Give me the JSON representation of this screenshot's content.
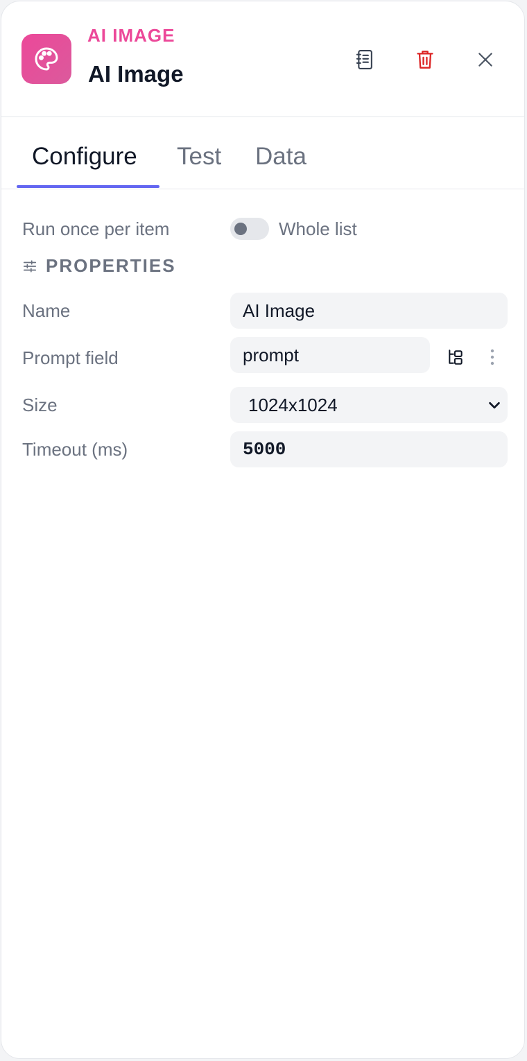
{
  "header": {
    "kind_label": "AI IMAGE",
    "title": "AI Image",
    "icon": "palette-icon",
    "accent_color": "#ec4899",
    "actions": [
      "docs-icon",
      "trash-icon",
      "close-icon"
    ]
  },
  "tabs": [
    {
      "label": "Configure",
      "active": true
    },
    {
      "label": "Test",
      "active": false
    },
    {
      "label": "Data",
      "active": false
    }
  ],
  "run_mode": {
    "label": "Run once per item",
    "toggle_text": "Whole list",
    "enabled": false
  },
  "properties": {
    "section_title": "PROPERTIES",
    "name": {
      "label": "Name",
      "value": "AI Image"
    },
    "prompt_field": {
      "label": "Prompt field",
      "value": "prompt"
    },
    "size": {
      "label": "Size",
      "value": "1024x1024"
    },
    "timeout": {
      "label": "Timeout (ms)",
      "value": "5000"
    }
  }
}
